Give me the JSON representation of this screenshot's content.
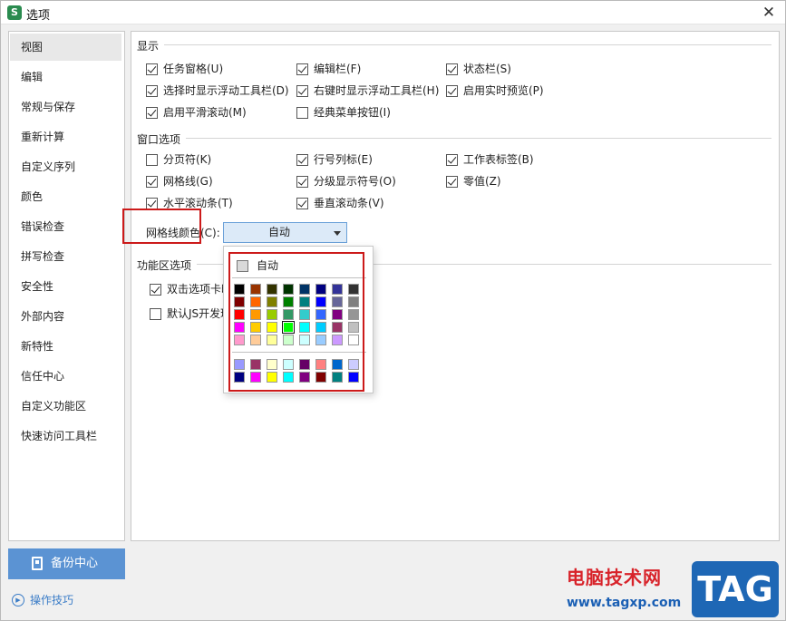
{
  "window": {
    "title": "选项",
    "app_icon": "S"
  },
  "sidebar": {
    "items": [
      {
        "label": "视图",
        "active": true
      },
      {
        "label": "编辑"
      },
      {
        "label": "常规与保存"
      },
      {
        "label": "重新计算"
      },
      {
        "label": "自定义序列"
      },
      {
        "label": "颜色"
      },
      {
        "label": "错误检查"
      },
      {
        "label": "拼写检查"
      },
      {
        "label": "安全性"
      },
      {
        "label": "外部内容"
      },
      {
        "label": "新特性"
      },
      {
        "label": "信任中心"
      },
      {
        "label": "自定义功能区"
      },
      {
        "label": "快速访问工具栏"
      }
    ],
    "backup_label": "备份中心",
    "tips_label": "操作技巧"
  },
  "display": {
    "title": "显示",
    "options": [
      {
        "label": "任务窗格(U)",
        "checked": true
      },
      {
        "label": "编辑栏(F)",
        "checked": true
      },
      {
        "label": "状态栏(S)",
        "checked": true
      },
      {
        "label": "选择时显示浮动工具栏(D)",
        "checked": true
      },
      {
        "label": "右键时显示浮动工具栏(H)",
        "checked": true
      },
      {
        "label": "启用实时预览(P)",
        "checked": true
      },
      {
        "label": "启用平滑滚动(M)",
        "checked": true
      },
      {
        "label": "经典菜单按钮(I)",
        "checked": false
      }
    ]
  },
  "window_options": {
    "title": "窗口选项",
    "options": [
      {
        "label": "分页符(K)",
        "checked": false
      },
      {
        "label": "行号列标(E)",
        "checked": true
      },
      {
        "label": "工作表标签(B)",
        "checked": true
      },
      {
        "label": "网格线(G)",
        "checked": true
      },
      {
        "label": "分级显示符号(O)",
        "checked": true
      },
      {
        "label": "零值(Z)",
        "checked": true
      },
      {
        "label": "水平滚动条(T)",
        "checked": true
      },
      {
        "label": "垂直滚动条(V)",
        "checked": true
      }
    ],
    "grid_color_label": "网格线颜色(C):",
    "grid_color_value": "自动"
  },
  "ribbon": {
    "title": "功能区选项",
    "options": [
      {
        "label": "双击选项卡时",
        "checked": true
      },
      {
        "label": "默认JS开发环",
        "checked": false
      }
    ]
  },
  "color_popup": {
    "auto_label": "自动",
    "main_rows": [
      [
        "#000000",
        "#993300",
        "#333300",
        "#003300",
        "#003366",
        "#000080",
        "#333399",
        "#333333"
      ],
      [
        "#800000",
        "#ff6600",
        "#808000",
        "#008000",
        "#008080",
        "#0000ff",
        "#666699",
        "#808080"
      ],
      [
        "#ff0000",
        "#ff9900",
        "#99cc00",
        "#339966",
        "#33cccc",
        "#3366ff",
        "#800080",
        "#969696"
      ],
      [
        "#ff00ff",
        "#ffcc00",
        "#ffff00",
        "#00ff00",
        "#00ffff",
        "#00ccff",
        "#993366",
        "#c0c0c0"
      ],
      [
        "#ff99cc",
        "#ffcc99",
        "#ffff99",
        "#ccffcc",
        "#ccffff",
        "#99ccff",
        "#cc99ff",
        "#ffffff"
      ]
    ],
    "extra_rows": [
      [
        "#9999ff",
        "#993366",
        "#ffffcc",
        "#ccffff",
        "#660066",
        "#ff8080",
        "#0066cc",
        "#ccccff"
      ],
      [
        "#000080",
        "#ff00ff",
        "#ffff00",
        "#00ffff",
        "#800080",
        "#800000",
        "#008080",
        "#0000ff"
      ]
    ],
    "selected": {
      "row": 3,
      "col": 3
    }
  },
  "watermark": {
    "cn": "电脑技术网",
    "url": "www.tagxp.com",
    "tag": "TAG"
  }
}
